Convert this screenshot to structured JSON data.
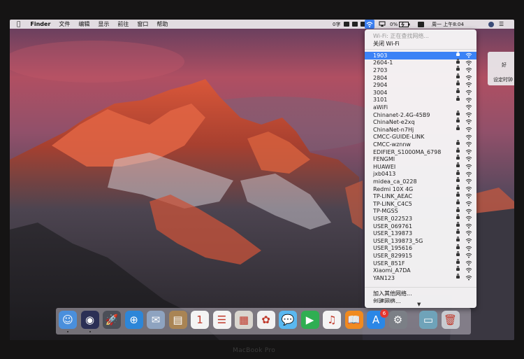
{
  "menubar": {
    "apple_icon": "apple-icon",
    "app_name": "Finder",
    "menus": [
      "文件",
      "编辑",
      "显示",
      "前往",
      "窗口",
      "帮助"
    ],
    "status": {
      "input_indicator": "0字",
      "battery_percent": "0%",
      "clock": "周一 上午8:04"
    }
  },
  "wifi_menu": {
    "status_text": "Wi-Fi: 正在查找网络...",
    "toggle_label": "关闭 Wi-Fi",
    "selected_network": "1903",
    "networks": [
      {
        "name": "1903",
        "locked": true
      },
      {
        "name": "2604-1",
        "locked": true
      },
      {
        "name": "2703",
        "locked": true
      },
      {
        "name": "2804",
        "locked": true
      },
      {
        "name": "2904",
        "locked": true
      },
      {
        "name": "3004",
        "locked": true
      },
      {
        "name": "3101",
        "locked": true
      },
      {
        "name": "aWiFi",
        "locked": false
      },
      {
        "name": "Chinanet-2.4G-45B9",
        "locked": true
      },
      {
        "name": "ChinaNet-e2xq",
        "locked": true
      },
      {
        "name": "ChinaNet-n7Hj",
        "locked": true
      },
      {
        "name": "CMCC-GUIDE-LINK",
        "locked": false
      },
      {
        "name": "CMCC-wznnw",
        "locked": true
      },
      {
        "name": "EDIFIER_S1000MA_6798",
        "locked": true
      },
      {
        "name": "FENGMI",
        "locked": true
      },
      {
        "name": "HUAWEI",
        "locked": true
      },
      {
        "name": "jxb0413",
        "locked": true
      },
      {
        "name": "midea_ca_0228",
        "locked": true
      },
      {
        "name": "Redmi 10X 4G",
        "locked": true
      },
      {
        "name": "TP-LINK_AEAC",
        "locked": true
      },
      {
        "name": "TP-LINK_C4C5",
        "locked": true
      },
      {
        "name": "TP-MGSS",
        "locked": true
      },
      {
        "name": "USER_022523",
        "locked": true
      },
      {
        "name": "USER_069761",
        "locked": true
      },
      {
        "name": "USER_139873",
        "locked": true
      },
      {
        "name": "USER_139873_5G",
        "locked": true
      },
      {
        "name": "USER_195616",
        "locked": true
      },
      {
        "name": "USER_829915",
        "locked": true
      },
      {
        "name": "USER_851F",
        "locked": true
      },
      {
        "name": "Xiaomi_A7DA",
        "locked": true
      },
      {
        "name": "YAN123",
        "locked": true
      }
    ],
    "join_other": "加入其他网络...",
    "create_network": "创建网络..."
  },
  "notification": {
    "ok_label": "好",
    "set_clock_label": "设定时钟"
  },
  "dock": {
    "apps": [
      {
        "name": "finder",
        "glyph": "☺",
        "color": "#4a8fdc"
      },
      {
        "name": "siri",
        "glyph": "◉",
        "color": "#2b2f55"
      },
      {
        "name": "launchpad",
        "glyph": "🚀",
        "color": "#4b4e57"
      },
      {
        "name": "safari",
        "glyph": "⊕",
        "color": "#2d86d8"
      },
      {
        "name": "mail",
        "glyph": "✉",
        "color": "#8ea3c0"
      },
      {
        "name": "contacts",
        "glyph": "▤",
        "color": "#a98454"
      },
      {
        "name": "calendar",
        "glyph": "1",
        "color": "#f4f4f4"
      },
      {
        "name": "reminders",
        "glyph": "☰",
        "color": "#f4f4f4"
      },
      {
        "name": "preview",
        "glyph": "▦",
        "color": "#d9d6cf"
      },
      {
        "name": "photos",
        "glyph": "✿",
        "color": "#f2f2f2"
      },
      {
        "name": "messages",
        "glyph": "💬",
        "color": "#5ab8f0"
      },
      {
        "name": "facetime",
        "glyph": "▶",
        "color": "#2fae52"
      },
      {
        "name": "itunes",
        "glyph": "♫",
        "color": "#f4f4f4"
      },
      {
        "name": "ibooks",
        "glyph": "📖",
        "color": "#f08a1f"
      },
      {
        "name": "app-store",
        "glyph": "A",
        "color": "#2b87e6"
      },
      {
        "name": "system-preferences",
        "glyph": "⚙",
        "color": "#7b7f86"
      },
      {
        "name": "downloads-folder",
        "glyph": "▭",
        "color": "#6fa3b9"
      },
      {
        "name": "trash",
        "glyph": "🗑",
        "color": "#c8cbd0"
      }
    ],
    "app_store_badge": "6"
  },
  "bezel_label": "MacBook Pro"
}
